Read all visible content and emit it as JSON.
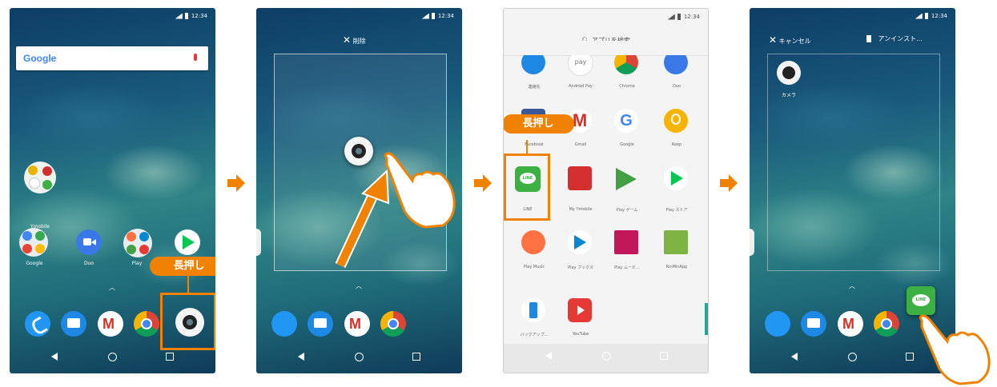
{
  "status_time": "12:34",
  "phone1": {
    "search_logo": "Google",
    "folder_label": "Ymobile",
    "dock_row_labels": [
      "Google",
      "Duo",
      "Play"
    ],
    "callout": "長押し"
  },
  "phone2": {
    "remove_label": "削除"
  },
  "phone3": {
    "search_placeholder": "アプリを検索",
    "row1_labels": [
      "連絡先",
      "Android Pay",
      "Chrome",
      "Duo"
    ],
    "row1_partial": "pay",
    "row2_labels": [
      "Facebook",
      "Gmail",
      "Google",
      "Keep"
    ],
    "row3_labels": [
      "LINE",
      "My Ymobile",
      "Play ゲーム",
      "Play ストア"
    ],
    "row4_labels": [
      "Play Music",
      "Play ブックス",
      "Play ムービ...",
      "RinMinApp"
    ],
    "row5_labels": [
      "バックアップ...",
      "YouTube"
    ],
    "line_icon_text": "LINE",
    "callout": "長押し"
  },
  "phone4": {
    "cancel_label": "キャンセル",
    "uninstall_label": "アンインスト...",
    "camera_label": "カメラ",
    "line_icon_text": "LINE"
  },
  "colors": {
    "accent": "#f08200",
    "line_green": "#3cb043"
  }
}
